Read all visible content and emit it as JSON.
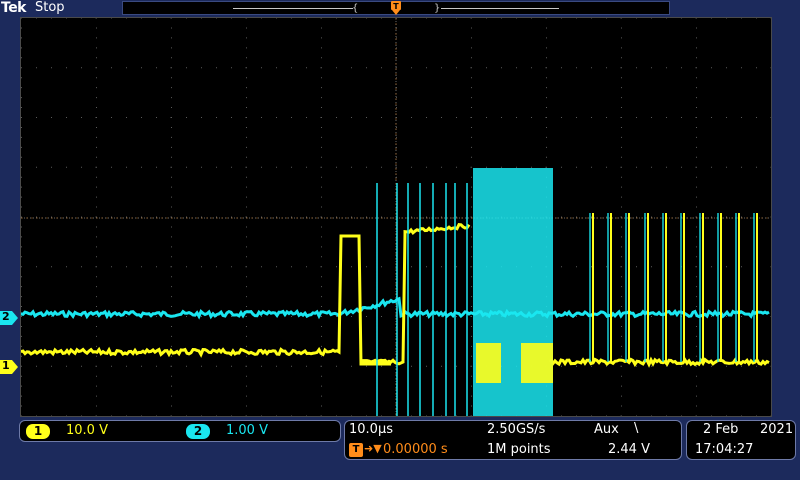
{
  "header": {
    "brand": "Tek",
    "run_status": "Stop"
  },
  "trigger_marker": {
    "label": "T"
  },
  "channels": [
    {
      "id": "1",
      "scale": "10.0 V",
      "color": "#ffff1a"
    },
    {
      "id": "2",
      "scale": "1.00 V",
      "color": "#1ae6f0"
    }
  ],
  "horizontal": {
    "time_per_div": "10.0µs",
    "sample_rate": "2.50GS/s",
    "trigger_delay": "0.00000 s",
    "record_length": "1M points",
    "trigger_marker_label": "T"
  },
  "trigger": {
    "source": "Aux",
    "slope_icon": "falling-edge",
    "slope_glyph": "\\",
    "level": "2.44 V"
  },
  "datetime": {
    "date_day_month": "2 Feb",
    "year": "2021",
    "time": "17:04:27"
  },
  "colors": {
    "background": "#1c2a5c",
    "graticule": "#000000",
    "ch1": "#ffff1a",
    "ch2": "#1ae6f0",
    "trigger": "#ff8c1a"
  }
}
